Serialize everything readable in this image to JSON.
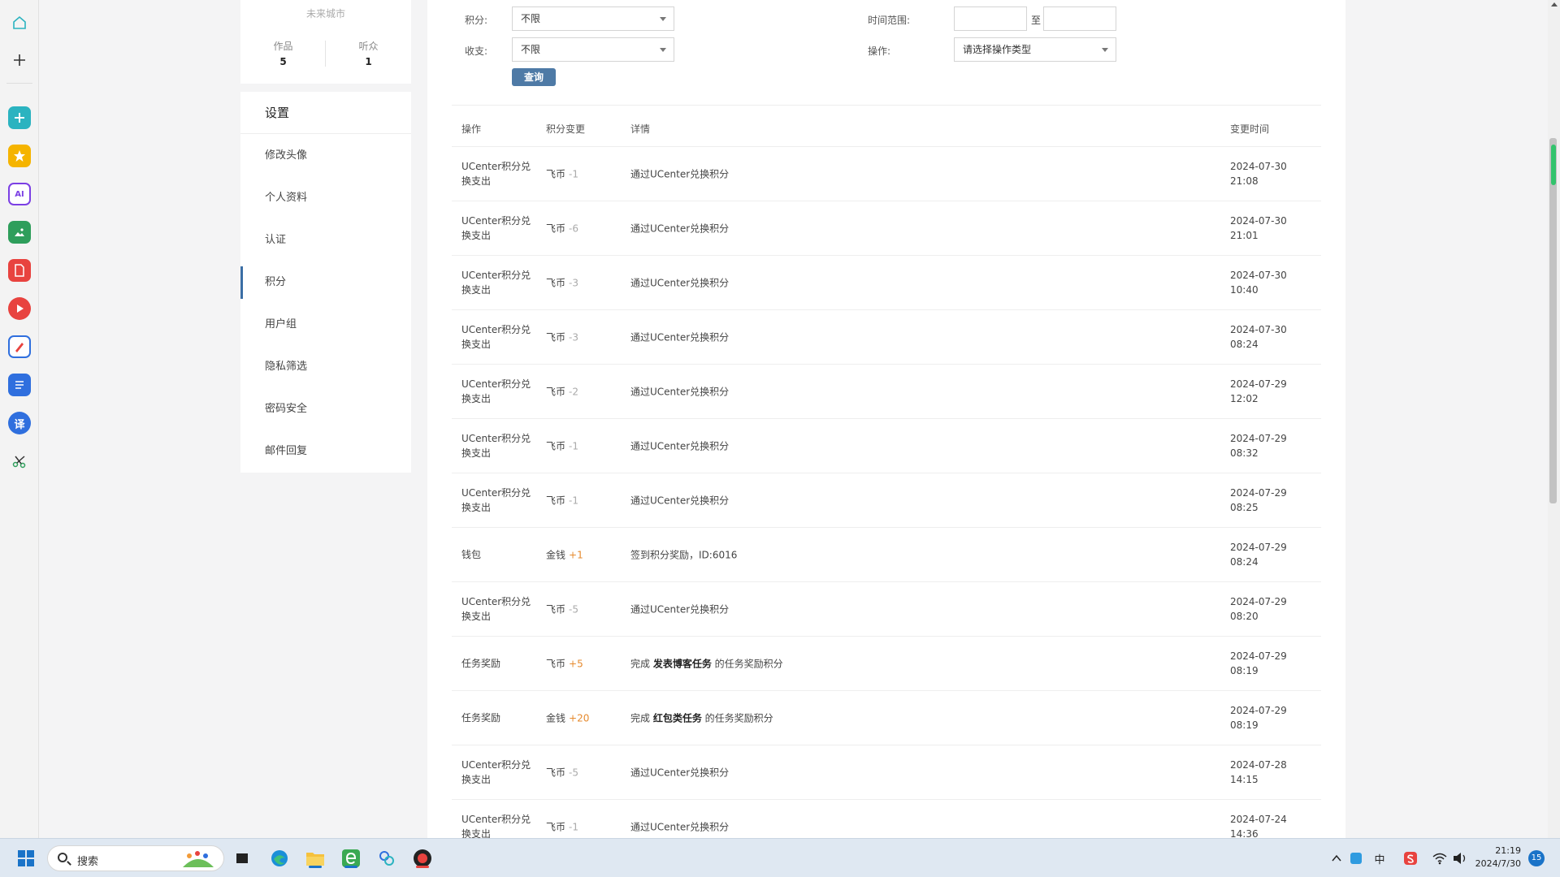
{
  "profile": {
    "city": "未来城市",
    "stats": [
      {
        "label": "作品",
        "value": "5"
      },
      {
        "label": "听众",
        "value": "1"
      }
    ]
  },
  "settings": {
    "title": "设置",
    "items": [
      {
        "label": "修改头像"
      },
      {
        "label": "个人资料"
      },
      {
        "label": "认证"
      },
      {
        "label": "积分",
        "active": true
      },
      {
        "label": "用户组"
      },
      {
        "label": "隐私筛选"
      },
      {
        "label": "密码安全"
      },
      {
        "label": "邮件回复"
      }
    ]
  },
  "filters": {
    "points_label": "积分:",
    "points_value": "不限",
    "income_label": "收支:",
    "income_value": "不限",
    "time_label": "时间范围:",
    "time_from": "",
    "time_sep": "至",
    "time_to": "",
    "op_label": "操作:",
    "op_value": "请选择操作类型",
    "query_button": "查询"
  },
  "table": {
    "headers": {
      "op": "操作",
      "change": "积分变更",
      "detail": "详情",
      "time": "变更时间"
    },
    "rows": [
      {
        "op": "UCenter积分兑换支出",
        "currency": "飞币",
        "amount": "-1",
        "detail": "通过UCenter兑换积分",
        "date": "2024-07-30",
        "clock": "21:08"
      },
      {
        "op": "UCenter积分兑换支出",
        "currency": "飞币",
        "amount": "-6",
        "detail": "通过UCenter兑换积分",
        "date": "2024-07-30",
        "clock": "21:01"
      },
      {
        "op": "UCenter积分兑换支出",
        "currency": "飞币",
        "amount": "-3",
        "detail": "通过UCenter兑换积分",
        "date": "2024-07-30",
        "clock": "10:40"
      },
      {
        "op": "UCenter积分兑换支出",
        "currency": "飞币",
        "amount": "-3",
        "detail": "通过UCenter兑换积分",
        "date": "2024-07-30",
        "clock": "08:24"
      },
      {
        "op": "UCenter积分兑换支出",
        "currency": "飞币",
        "amount": "-2",
        "detail": "通过UCenter兑换积分",
        "date": "2024-07-29",
        "clock": "12:02"
      },
      {
        "op": "UCenter积分兑换支出",
        "currency": "飞币",
        "amount": "-1",
        "detail": "通过UCenter兑换积分",
        "date": "2024-07-29",
        "clock": "08:32"
      },
      {
        "op": "UCenter积分兑换支出",
        "currency": "飞币",
        "amount": "-1",
        "detail": "通过UCenter兑换积分",
        "date": "2024-07-29",
        "clock": "08:25"
      },
      {
        "op": "钱包",
        "currency": "金钱",
        "amount": "+1",
        "detail": "签到积分奖励，ID:6016",
        "date": "2024-07-29",
        "clock": "08:24"
      },
      {
        "op": "UCenter积分兑换支出",
        "currency": "飞币",
        "amount": "-5",
        "detail": "通过UCenter兑换积分",
        "date": "2024-07-29",
        "clock": "08:20"
      },
      {
        "op": "任务奖励",
        "currency": "飞币",
        "amount": "+5",
        "detail_pre": "完成 ",
        "detail_bold": "发表博客任务",
        "detail_post": " 的任务奖励积分",
        "date": "2024-07-29",
        "clock": "08:19"
      },
      {
        "op": "任务奖励",
        "currency": "金钱",
        "amount": "+20",
        "detail_pre": "完成 ",
        "detail_bold": "红包类任务",
        "detail_post": " 的任务奖励积分",
        "date": "2024-07-29",
        "clock": "08:19"
      },
      {
        "op": "UCenter积分兑换支出",
        "currency": "飞币",
        "amount": "-5",
        "detail": "通过UCenter兑换积分",
        "date": "2024-07-28",
        "clock": "14:15"
      },
      {
        "op": "UCenter积分兑换支出",
        "currency": "飞币",
        "amount": "-1",
        "detail": "通过UCenter兑换积分",
        "date": "2024-07-24",
        "clock": "14:36"
      }
    ]
  },
  "dock": {
    "icons": [
      "home-icon",
      "plus-icon",
      "app-add-icon",
      "star-icon",
      "ai-chat-icon",
      "ai-image-icon",
      "ai-pdf-icon",
      "ai-video-icon",
      "ai-draw-icon",
      "ai-doc-icon",
      "translate-icon",
      "scissors-icon"
    ],
    "translate_glyph": "译",
    "colors": {
      "teal": "#2bb3c0",
      "yellow": "#f5b400",
      "purple": "#7b3fe4",
      "green": "#2e9e5b",
      "red": "#e8433f",
      "blue": "#2f6fde"
    }
  },
  "taskbar": {
    "search_placeholder": "搜索",
    "time": "21:19",
    "date": "2024/7/30",
    "notifications": "15",
    "ime_label": "中"
  },
  "colors": {
    "accent": "#3b6ea5",
    "button": "#4e7aa6",
    "positive": "#e68a2e",
    "negative": "#aaaaaa"
  }
}
